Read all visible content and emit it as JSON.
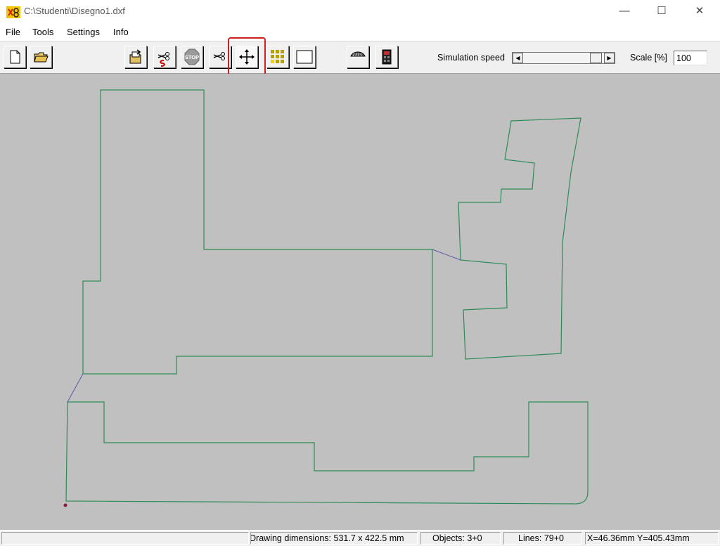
{
  "window": {
    "title": "C:\\Studenti\\Disegno1.dxf",
    "minimize_glyph": "—",
    "maximize_glyph": "☐",
    "close_glyph": "✕"
  },
  "menu": [
    "File",
    "Tools",
    "Settings",
    "Info"
  ],
  "toolbar": {
    "buttons": [
      {
        "name": "new-file-icon"
      },
      {
        "name": "open-folder-icon"
      },
      {
        "name": "export-icon"
      },
      {
        "name": "cut-simulation-icon"
      },
      {
        "name": "stop-icon",
        "label": "STOP"
      },
      {
        "name": "cut-icon"
      },
      {
        "name": "move-icon",
        "selected": true
      },
      {
        "name": "grid-icon"
      },
      {
        "name": "rectangle-icon"
      },
      {
        "name": "machine-icon"
      },
      {
        "name": "controller-icon"
      }
    ],
    "simulation_speed_label": "Simulation speed",
    "scale_label": "Scale [%]",
    "scale_value": "100"
  },
  "colors": {
    "canvas": "#c0c0c0",
    "path": "#2e8b57",
    "travel": "#5a5aa8",
    "highlight": "#cc1f1f"
  },
  "status": {
    "empty": "",
    "drawing_dimensions": "Drawing dimensions: 531.7 x 422.5 mm",
    "objects": "Objects: 3+0",
    "lines": "Lines: 79+0",
    "coords": "X=46.36mm Y=405.43mm"
  }
}
